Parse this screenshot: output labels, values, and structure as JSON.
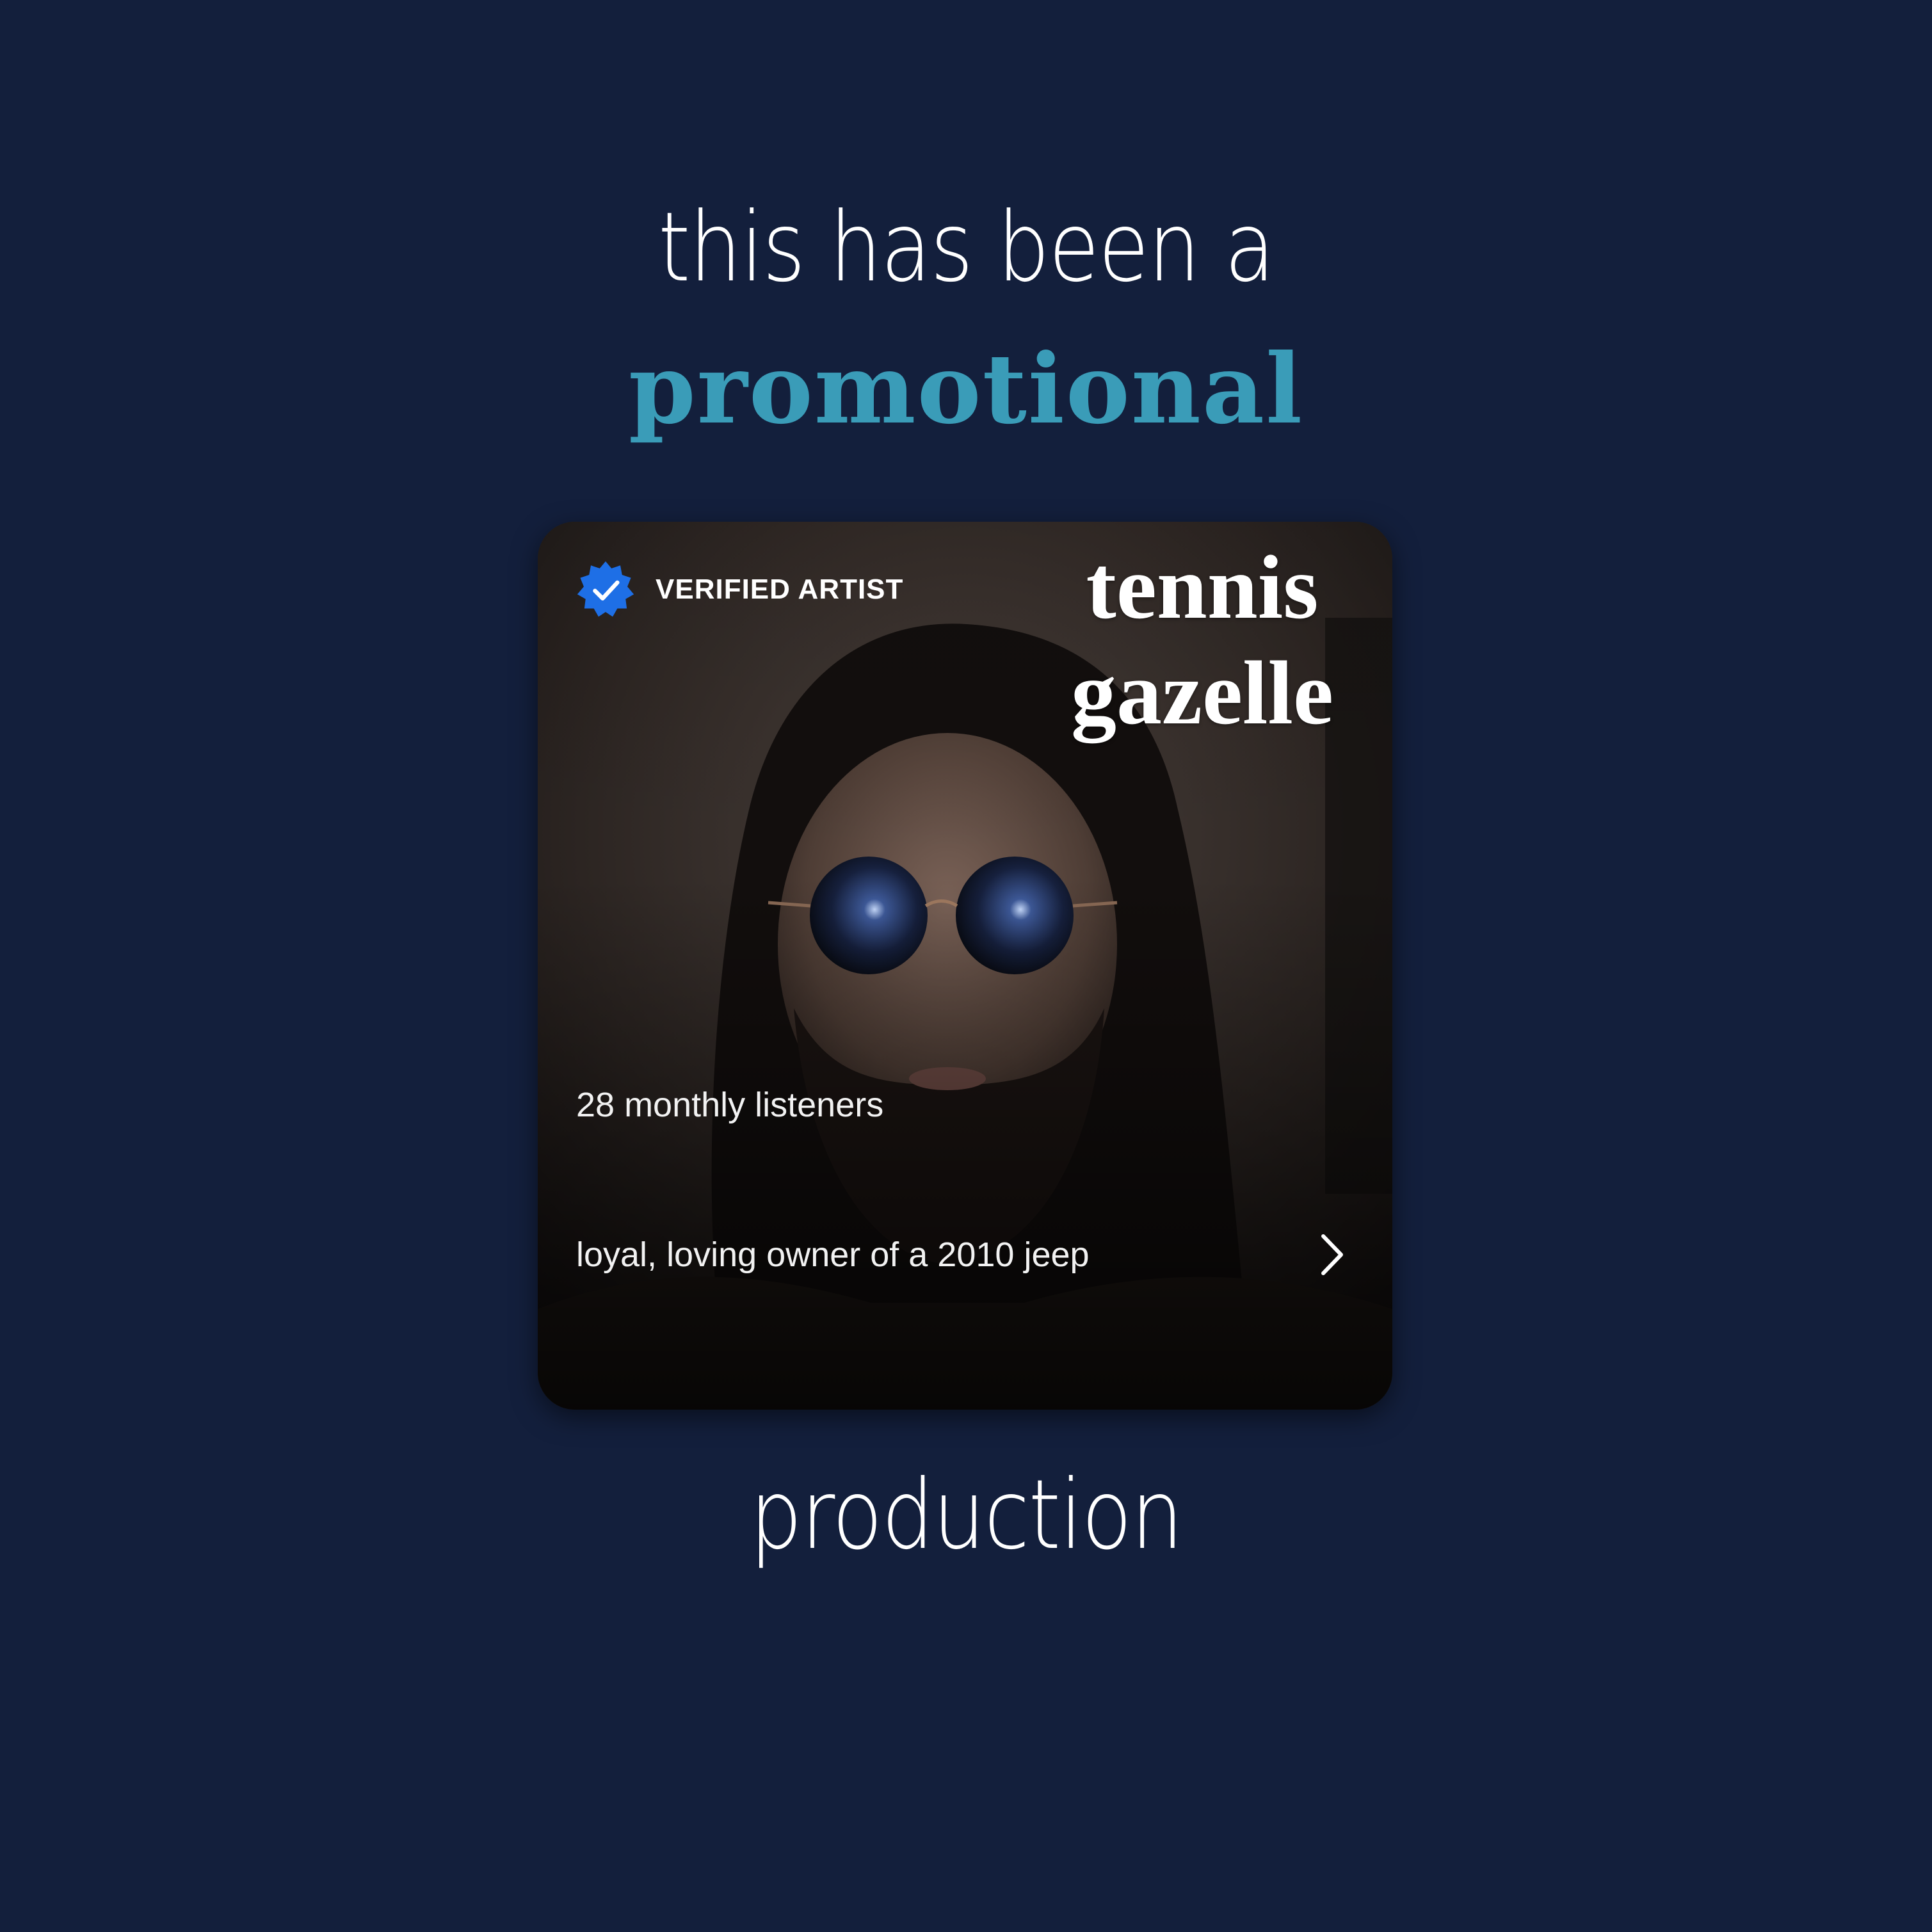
{
  "headline": {
    "line1": "this has been a",
    "line2": "promotional",
    "line3": "production"
  },
  "card": {
    "badge_icon": "verified-badge-icon",
    "badge_label": "VERIFIED ARTIST",
    "artist_name_line1": "tennis",
    "artist_name_line2": "gazelle",
    "monthly_listeners": "28 monthly listeners",
    "bio": "loyal, loving owner of a 2010 jeep",
    "more_icon": "chevron-right-icon"
  },
  "colors": {
    "background": "#131f3c",
    "accent": "#3a9cb8",
    "badge": "#1e6fe6",
    "text": "#ffffff"
  }
}
